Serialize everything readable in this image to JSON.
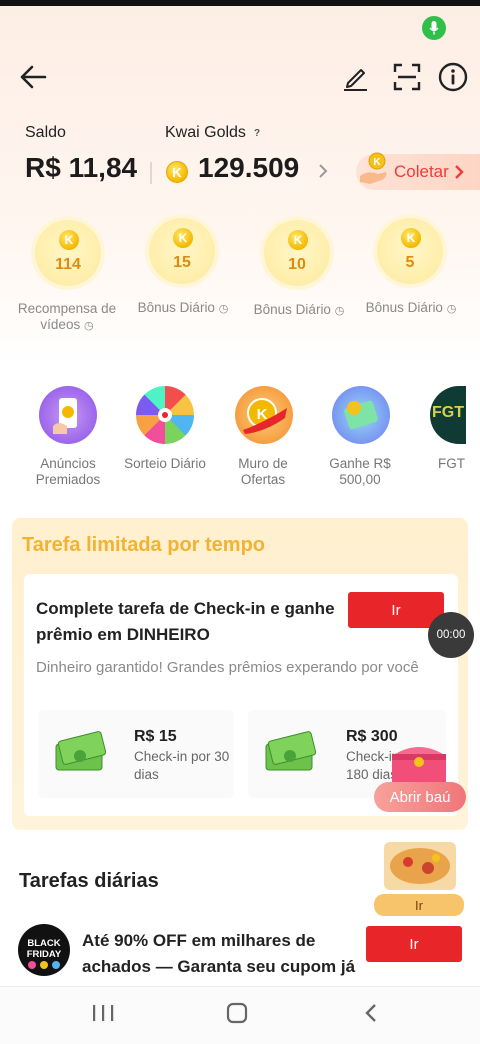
{
  "header": {
    "back": "back-arrow",
    "edit": "edit-pencil",
    "scan": "scan-frame",
    "info": "info-circle"
  },
  "wallet": {
    "saldo_label": "Saldo",
    "saldo_value": "R$ 11,84",
    "golds_label": "Kwai Golds",
    "golds_help": "?",
    "golds_value": "129.509",
    "coletar_label": "Coletar"
  },
  "bonus": [
    {
      "value": "114",
      "label": "Recompensa de vídeos"
    },
    {
      "value": "15",
      "label": "Bônus Diário"
    },
    {
      "value": "10",
      "label": "Bônus Diário"
    },
    {
      "value": "5",
      "label": "Bônus Diário"
    }
  ],
  "features": [
    {
      "label": "Anúncios Premiados"
    },
    {
      "label": "Sorteio Diário"
    },
    {
      "label": "Muro de Ofertas"
    },
    {
      "label": "Ganhe R$ 500,00"
    },
    {
      "label": "FGT",
      "badge": "FGT"
    }
  ],
  "limited_task": {
    "title": "Tarefa limitada por tempo",
    "headline": "Complete tarefa de Check-in e ganhe prêmio em DINHEIRO",
    "button": "Ir",
    "description": "Dinheiro garantido! Grandes prêmios experando por você",
    "rewards": [
      {
        "amount": "R$ 15",
        "subtitle": "Check-in por 30 dias"
      },
      {
        "amount": "R$ 300",
        "subtitle": "Check-in por 180 dias"
      }
    ]
  },
  "floating": {
    "timer": "00:00",
    "chest_label": "Abrir baú",
    "food_button": "Ir"
  },
  "daily": {
    "title": "Tarefas diárias",
    "avatar_text": "BLACK FRIDAY",
    "task_text": "Até 90% OFF em milhares de achados — Garanta seu cupom já",
    "button": "Ir"
  },
  "colors": {
    "accent_red": "#e8262a",
    "gold": "#f5b800",
    "task_title": "#f2b233"
  }
}
